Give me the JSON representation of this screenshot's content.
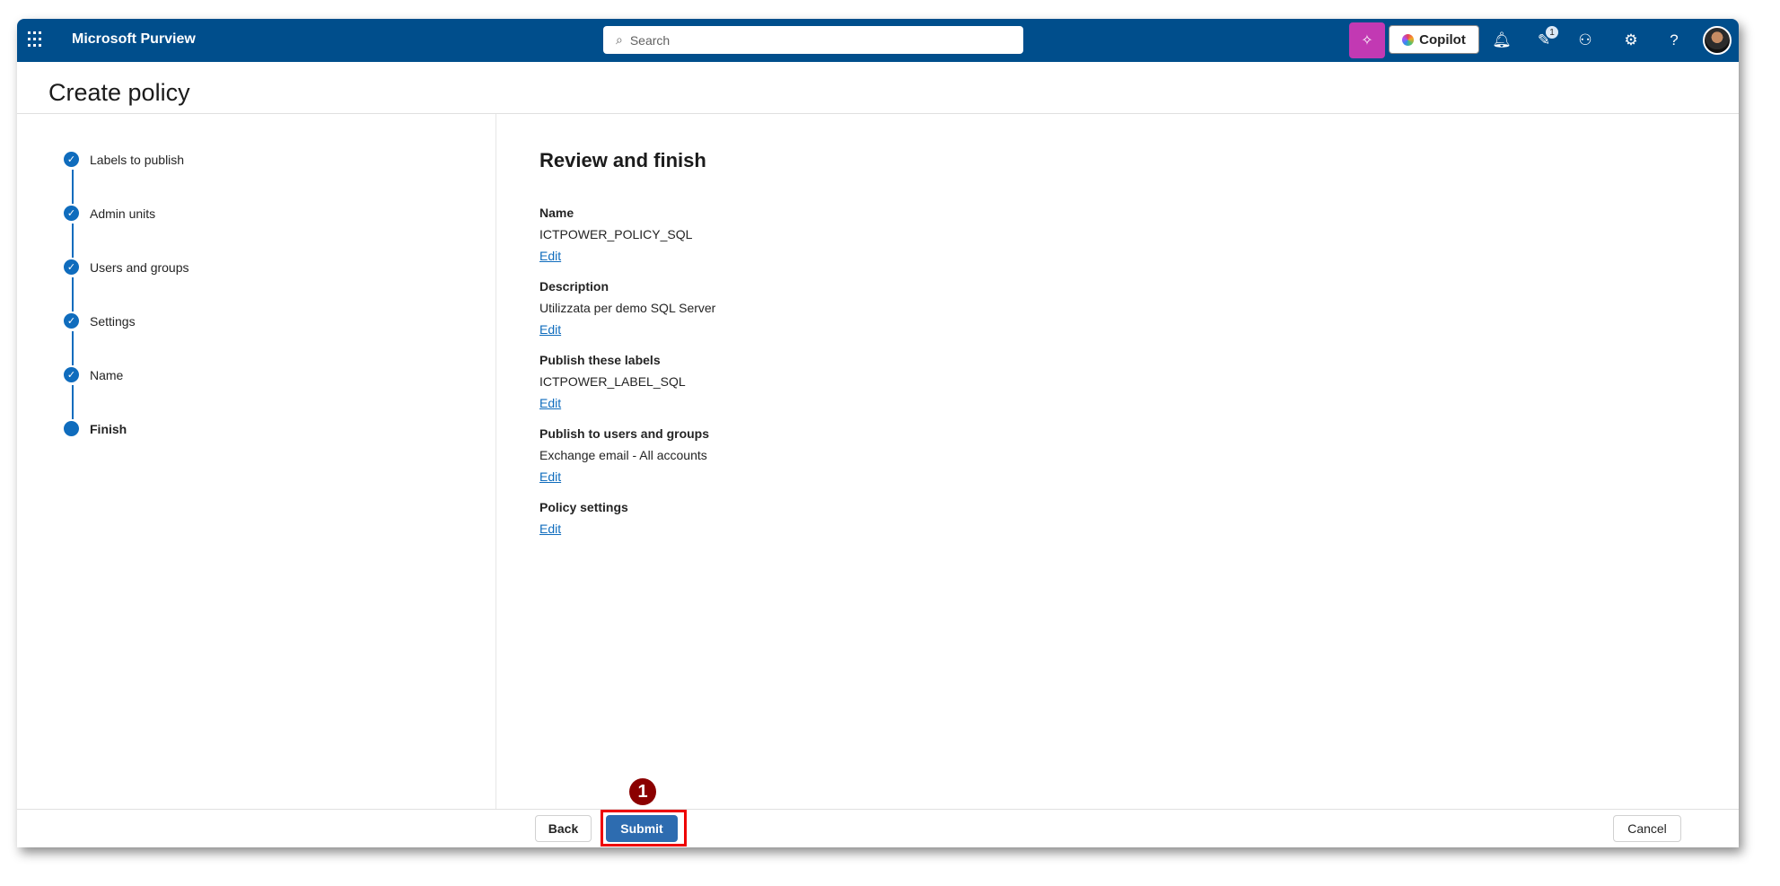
{
  "header": {
    "app_name": "Microsoft Purview",
    "search_placeholder": "Search",
    "copilot_label": "Copilot",
    "notification_count": "1",
    "help": "?"
  },
  "page": {
    "title": "Create policy"
  },
  "steps": [
    {
      "label": "Labels to publish",
      "status": "done"
    },
    {
      "label": "Admin units",
      "status": "done"
    },
    {
      "label": "Users and groups",
      "status": "done"
    },
    {
      "label": "Settings",
      "status": "done"
    },
    {
      "label": "Name",
      "status": "done"
    },
    {
      "label": "Finish",
      "status": "current"
    }
  ],
  "review": {
    "title": "Review and finish",
    "sections": [
      {
        "label": "Name",
        "value": "ICTPOWER_POLICY_SQL",
        "edit": "Edit"
      },
      {
        "label": "Description",
        "value": "Utilizzata per demo SQL Server",
        "edit": "Edit"
      },
      {
        "label": "Publish these labels",
        "value": "ICTPOWER_LABEL_SQL",
        "edit": "Edit"
      },
      {
        "label": "Publish to users and groups",
        "value": "Exchange email - All accounts",
        "edit": "Edit"
      },
      {
        "label": "Policy settings",
        "edit": "Edit"
      }
    ]
  },
  "footer": {
    "back": "Back",
    "submit": "Submit",
    "cancel": "Cancel"
  },
  "annotation": {
    "marker": "1"
  },
  "colors": {
    "header": "#004e8c",
    "accent": "#0f6cbd",
    "submit": "#2d6cb0",
    "annotation": "#e00000"
  }
}
